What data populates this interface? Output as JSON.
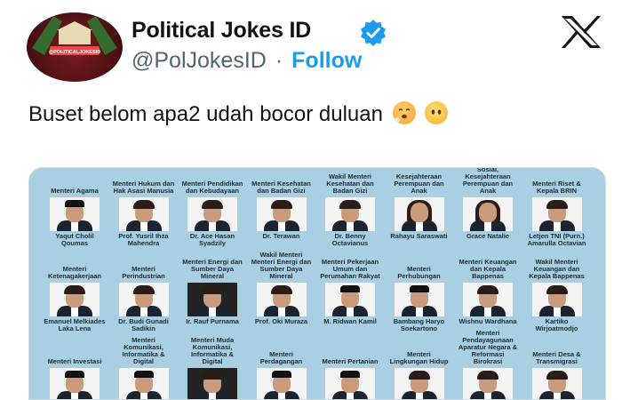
{
  "author": {
    "name": "Political Jokes ID",
    "handle": "@PolJokesID",
    "separator": "·",
    "follow_label": "Follow",
    "avatar_text": "@POLITICALJOKESID",
    "verified": true
  },
  "platform_icon": "x-logo-icon",
  "tweet": {
    "text": "Buset belom apa2 udah bocor duluan",
    "emojis": [
      "face-exhaling-emoji",
      "face-without-mouth-emoji"
    ]
  },
  "colors": {
    "accent": "#1d9bf0",
    "media_bg": "#a9cfe3",
    "text": "#0f1419",
    "muted": "#536471"
  },
  "media": {
    "rows": [
      [
        {
          "title": "Menteri Agama",
          "name": "Yaqut Cholil Qoumas",
          "look": "cap"
        },
        {
          "title": "Menteri Hukum dan Hak Asasi Manusia",
          "name": "Prof. Yusril Ihza Mahendra",
          "look": "hair"
        },
        {
          "title": "Menteri Pendidikan dan Kebudayaan",
          "name": "Dr. Ace Hasan Syadzily",
          "look": "hair"
        },
        {
          "title": "Menteri Kesehatan dan Badan Gizi",
          "name": "Dr. Terawan",
          "look": "hair"
        },
        {
          "title": "Wakil Menteri Kesehatan dan Badan Gizi",
          "name": "Dr. Benny Octavianus",
          "look": "hair"
        },
        {
          "title": "Kesejahteraan Perempuan dan Anak",
          "name": "Rahayu Saraswati",
          "look": "long"
        },
        {
          "title": "Sosial, Kesejahteraan Perempuan dan Anak",
          "name": "Grace Natalie",
          "look": "long"
        },
        {
          "title": "Menteri Riset & Kepala BRIN",
          "name": "Letjen TNI (Purn.) Amarulla Octavian",
          "look": "hair"
        }
      ],
      [
        {
          "title": "Menteri Ketenagakerjaan",
          "name": "Emanuel Melkiades Laka Lena",
          "look": "hair"
        },
        {
          "title": "Menteri Perindustrian",
          "name": "Dr. Budi Gunadi Sadikin",
          "look": "hair"
        },
        {
          "title": "Menteri Energi dan Sumber Daya Mineral",
          "name": "Ir. Rauf Purnama",
          "look": "dark"
        },
        {
          "title": "Wakil Menteri Menteri Energi dan Sumber Daya Mineral",
          "name": "Prof. Oki Muraza",
          "look": "hair"
        },
        {
          "title": "Menteri Pekerjaan Umum dan Perumahan Rakyat",
          "name": "M. Ridwan Kamil",
          "look": "cap"
        },
        {
          "title": "Menteri Perhubungan",
          "name": "Bambang Haryo Soekartono",
          "look": "cap"
        },
        {
          "title": "Menteri Keuangan dan Kepala Bappenas",
          "name": "Wishnu Wardhana",
          "look": "hair"
        },
        {
          "title": "Wakil Menteri Keuangan dan Kepala Bappenas",
          "name": "Kartiko Wirjoatmodjo",
          "look": "hair"
        }
      ],
      [
        {
          "title": "Menteri Investasi",
          "name": "",
          "look": "cap"
        },
        {
          "title": "Menteri Komunikasi, Informatika & Digital",
          "name": "",
          "look": "cap"
        },
        {
          "title": "Menteri Muda Komunikasi, Informatika & Digital",
          "name": "",
          "look": "dark"
        },
        {
          "title": "Menteri Perdagangan",
          "name": "",
          "look": "cap"
        },
        {
          "title": "Menteri Pertanian",
          "name": "",
          "look": "cap"
        },
        {
          "title": "Menteri Lingkungan Hidup",
          "name": "",
          "look": "hair"
        },
        {
          "title": "Menteri Pendayagunaan Aparatur Negara & Reformasi Birokrasi",
          "name": "",
          "look": "hair"
        },
        {
          "title": "Menteri Desa & Transmigrasi",
          "name": "",
          "look": "hair"
        }
      ]
    ]
  }
}
